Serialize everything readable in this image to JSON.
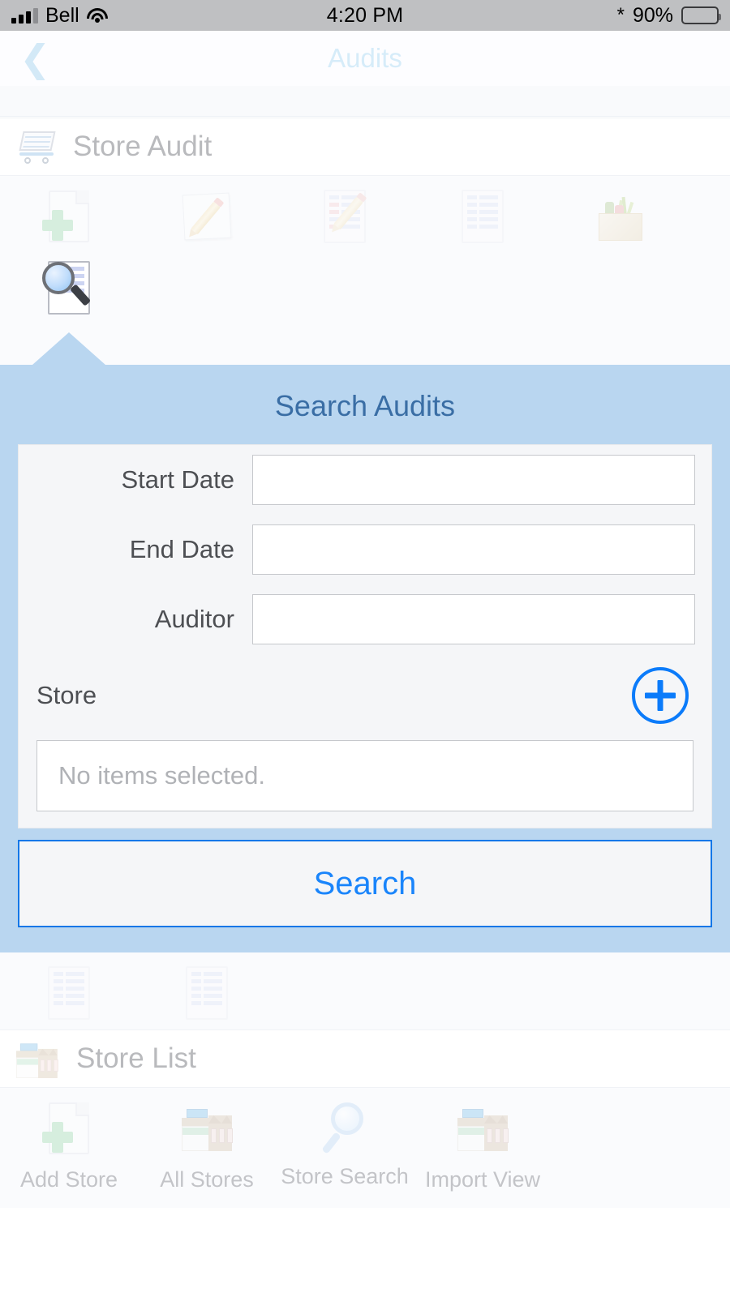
{
  "status_bar": {
    "carrier": "Bell",
    "time": "4:20 PM",
    "battery_percent": "90%",
    "signal_icon": "cellular-bars-icon",
    "wifi_icon": "wifi-icon",
    "bluetooth_icon": "bluetooth-icon",
    "battery_icon": "battery-icon"
  },
  "nav_bar": {
    "title": "Audits",
    "back_icon": "back-chevron-icon"
  },
  "sections": {
    "store_audit": {
      "label": "Store Audit",
      "icon": "shopping-cart-icon",
      "items": [
        {
          "icon": "add-document-icon",
          "label": ""
        },
        {
          "icon": "notepad-pencil-icon",
          "label": ""
        },
        {
          "icon": "edit-form-icon",
          "label": ""
        },
        {
          "icon": "list-document-icon",
          "label": ""
        },
        {
          "icon": "grocery-bag-icon",
          "label": ""
        },
        {
          "icon": "search-document-icon",
          "label": "",
          "selected": true
        }
      ]
    },
    "after_panel": {
      "items": [
        {
          "icon": "list-document-icon",
          "label": ""
        },
        {
          "icon": "list-document-icon",
          "label": ""
        }
      ]
    },
    "store_list": {
      "label": "Store List",
      "icon": "storefront-icon",
      "items": [
        {
          "icon": "add-document-icon",
          "label": "Add Store"
        },
        {
          "icon": "storefront-icon",
          "label": "All Stores"
        },
        {
          "icon": "magnifier-icon",
          "label": "Store Search"
        },
        {
          "icon": "storefront-icon",
          "label": "Import View"
        }
      ]
    }
  },
  "search_panel": {
    "title": "Search Audits",
    "fields": [
      {
        "label": "Start Date",
        "value": "",
        "placeholder": ""
      },
      {
        "label": "End Date",
        "value": "",
        "placeholder": ""
      },
      {
        "label": "Auditor",
        "value": "",
        "placeholder": ""
      }
    ],
    "store": {
      "label": "Store",
      "add_icon": "plus-circle-icon",
      "selection_placeholder": "No items selected."
    },
    "search_button_label": "Search"
  },
  "colors": {
    "panel_bg": "#b9d6f0",
    "panel_title": "#3a6ea5",
    "accent_blue": "#0b7bfa",
    "status_bar_bg": "#bfc0c2",
    "muted_text": "#b9babd"
  }
}
